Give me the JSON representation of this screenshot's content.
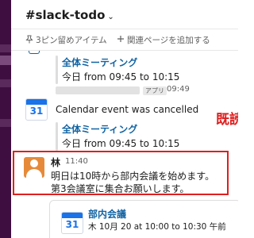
{
  "header": {
    "channel_name": "#slack-todo",
    "chevron": "⌄"
  },
  "bookmarks": {
    "pins_label": "3ピン留めアイテム",
    "add_label": "関連ページを追加する"
  },
  "messages": {
    "first_block": {
      "event_title": "全体ミーティング",
      "event_time": "今日 from 09:45 to 10:15"
    },
    "app_message": {
      "icon_text": "31",
      "badge": "アプリ",
      "time": "09:49",
      "text": "Calendar event was cancelled",
      "event_title": "全体ミーティング",
      "event_time": "今日 from 09:45 to 10:15"
    },
    "user_message": {
      "author": "林",
      "time": "11:40",
      "line1": "明日は10時から部内会議を始めます。",
      "line2": "第3会議室に集合お願いします。"
    },
    "event_card": {
      "icon_text": "31",
      "title": "部内会議",
      "date": "木 10月 20 at 10:00 to 10:30 午前"
    }
  },
  "annotation": {
    "text": "既読",
    "color": "#e01e1e"
  },
  "colors": {
    "sidebar": "#3f0e40",
    "link": "#1264a3",
    "highlight_border": "#e01e1e",
    "avatar": "#e68a3a"
  },
  "icons": {
    "pin": "pin-icon",
    "add": "plus-icon",
    "calendar": "calendar-icon",
    "avatar": "user-avatar-icon"
  }
}
